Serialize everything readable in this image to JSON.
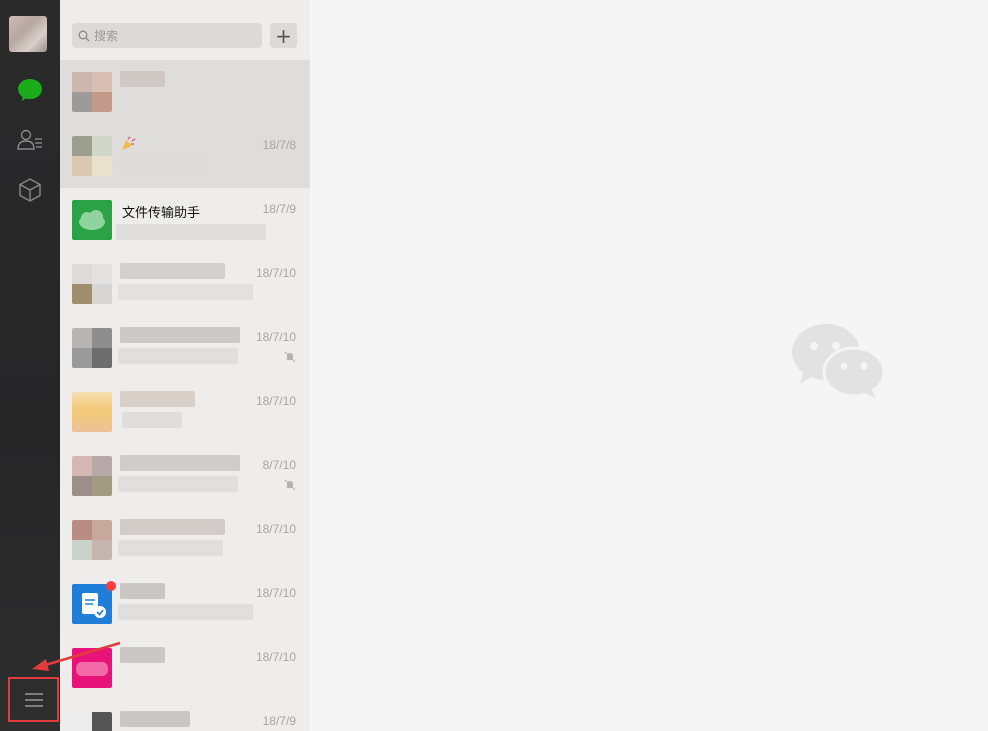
{
  "search": {
    "placeholder": "搜索"
  },
  "add_button": "+",
  "chats": [
    {
      "name": "",
      "time": ""
    },
    {
      "name": "",
      "time": "18/7/8"
    },
    {
      "name": "文件传输助手",
      "time": "18/7/9"
    },
    {
      "name": "",
      "time": "18/7/10"
    },
    {
      "name": "",
      "time": "18/7/10"
    },
    {
      "name": "",
      "time": "18/7/10"
    },
    {
      "name": "",
      "time": "8/7/10"
    },
    {
      "name": "",
      "time": "18/7/10"
    },
    {
      "name": "",
      "time": "18/7/10"
    },
    {
      "name": "",
      "time": "18/7/10"
    },
    {
      "name": "",
      "time": "18/7/9"
    }
  ],
  "colors": {
    "accent_green": "#1aad19",
    "highlight_red": "#e03c3c"
  },
  "icons": {
    "chat": "chat-bubble-icon",
    "contacts": "contacts-icon",
    "favorites": "cube-icon",
    "menu": "hamburger-menu-icon"
  }
}
